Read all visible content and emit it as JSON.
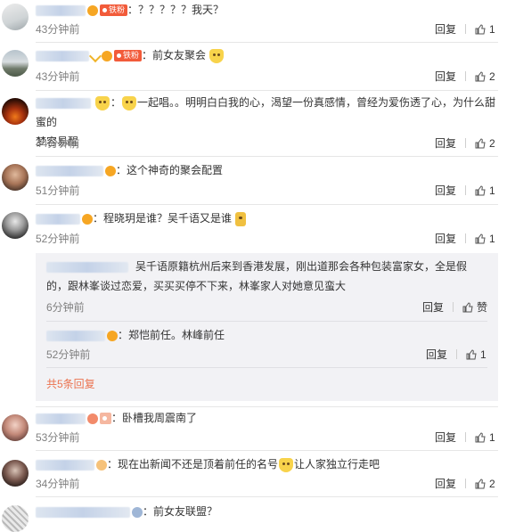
{
  "actions": {
    "reply_label": "回复",
    "like_label": "赞"
  },
  "comments": [
    {
      "text": "：？？？？？我天？",
      "time": "43分钟前",
      "likes": "1"
    },
    {
      "text": "：前女友聚会",
      "time": "43分钟前",
      "likes": "2"
    },
    {
      "text_a": "：",
      "text_b": "一起唱。。明明白白我的心，渴望一份真感情，曾经为爱伤透了心，为什么甜蜜的",
      "text_c": "梦容易醒",
      "time": "44分钟前",
      "likes": "2"
    },
    {
      "text": "：这个神奇的聚会配置",
      "time": "51分钟前",
      "likes": "1"
    },
    {
      "text": "：程晓玥是谁？吴千语又是谁",
      "time": "52分钟前",
      "likes": "1",
      "replies": [
        {
          "text_a": "吴千语原籍杭州后来到香港发展，刚出道那会各种包装富家女，全是假",
          "text_b": "的，跟林峯谈过恋爱，买买买停不下来，林峯家人对她意见蛮大",
          "time": "6分钟前",
          "likes": "赞"
        },
        {
          "text": "：郑恺前任。林峰前任",
          "time": "52分钟前",
          "likes": "1"
        }
      ],
      "more_replies": "共5条回复"
    },
    {
      "text": "：卧槽我周震南了",
      "time": "53分钟前",
      "likes": "1"
    },
    {
      "text": "：现在出新闻不还是顶着前任的名号",
      "text_after": "让人家独立行走吧",
      "time": "34分钟前",
      "likes": "2"
    },
    {
      "text": "：前女友联盟？"
    }
  ],
  "colors": {
    "link_orange": "#eb7350",
    "time_gray": "#808080",
    "badge_red": "#f25b3a"
  }
}
